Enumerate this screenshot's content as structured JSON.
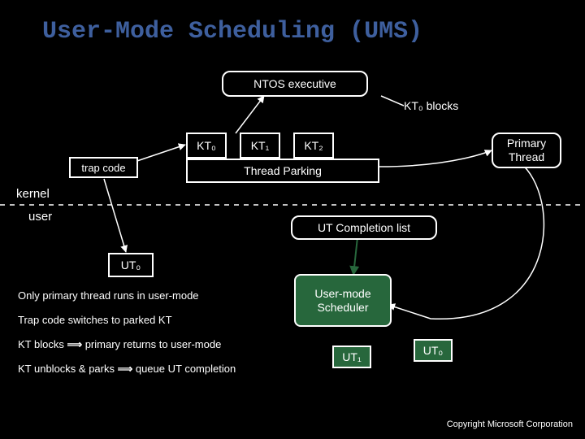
{
  "title": "User-Mode Scheduling (UMS)",
  "ntos": "NTOS executive",
  "kt_blocks": "KT₀ blocks",
  "kt0": "KT₀",
  "kt1": "KT₁",
  "kt2": "KT₂",
  "thread_parking": "Thread Parking",
  "trap_code": "trap code",
  "kernel": "kernel",
  "user": "user",
  "ut_completion": "UT Completion list",
  "primary_thread": "Primary Thread",
  "ut0_box": "UT₀",
  "scheduler": "User-mode Scheduler",
  "ut1_green": "UT₁",
  "ut0_green": "UT₀",
  "bullet1": "Only primary thread runs in user-mode",
  "bullet2": "Trap code switches to parked KT",
  "bullet3_a": "KT blocks ",
  "bullet3_b": " primary returns to user-mode",
  "bullet4_a": "KT unblocks & parks ",
  "bullet4_b": " queue UT completion",
  "arrow": "⟹",
  "copyright": "Copyright Microsoft Corporation"
}
